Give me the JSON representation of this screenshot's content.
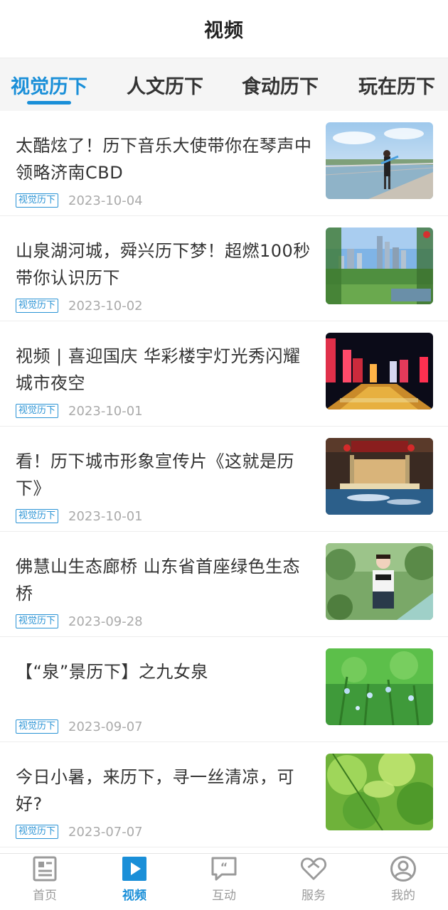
{
  "header": {
    "title": "视频"
  },
  "tabs": [
    {
      "label": "视觉历下",
      "active": true
    },
    {
      "label": "人文历下",
      "active": false
    },
    {
      "label": "食动历下",
      "active": false
    },
    {
      "label": "玩在历下",
      "active": false
    }
  ],
  "items": [
    {
      "title": "太酷炫了！历下音乐大使带你在琴声中领略济南CBD",
      "tag": "视觉历下",
      "date": "2023-10-04",
      "thumb": "musician-on-bridge"
    },
    {
      "title": "山泉湖河城，舜兴历下梦！超燃100秒带你认识历下",
      "tag": "视觉历下",
      "date": "2023-10-02",
      "thumb": "city-skyline-day"
    },
    {
      "title": "视频 | 喜迎国庆 华彩楼宇灯光秀闪耀城市夜空",
      "tag": "视觉历下",
      "date": "2023-10-01",
      "thumb": "city-night-lights"
    },
    {
      "title": "看！历下城市形象宣传片《这就是历下》",
      "tag": "视觉历下",
      "date": "2023-10-01",
      "thumb": "stage-on-water"
    },
    {
      "title": "佛慧山生态廊桥 山东省首座绿色生态桥",
      "tag": "视觉历下",
      "date": "2023-09-28",
      "thumb": "woman-in-park"
    },
    {
      "title": "【“泉”景历下】之九女泉",
      "tag": "视觉历下",
      "date": "2023-09-07",
      "thumb": "green-plants"
    },
    {
      "title": "今日小暑，来历下，寻一丝清凉，可好?",
      "tag": "视觉历下",
      "date": "2023-07-07",
      "thumb": "green-leaves"
    }
  ],
  "bottom_nav": [
    {
      "label": "首页",
      "icon": "news-icon",
      "active": false
    },
    {
      "label": "视频",
      "icon": "play-icon",
      "active": true
    },
    {
      "label": "互动",
      "icon": "chat-quote-icon",
      "active": false
    },
    {
      "label": "服务",
      "icon": "heart-service-icon",
      "active": false
    },
    {
      "label": "我的",
      "icon": "user-icon",
      "active": false
    }
  ],
  "colors": {
    "accent": "#1a8fd8",
    "tag": "#2a93d5",
    "date": "#aaaaaa",
    "inactive_nav": "#9a9a9a"
  }
}
